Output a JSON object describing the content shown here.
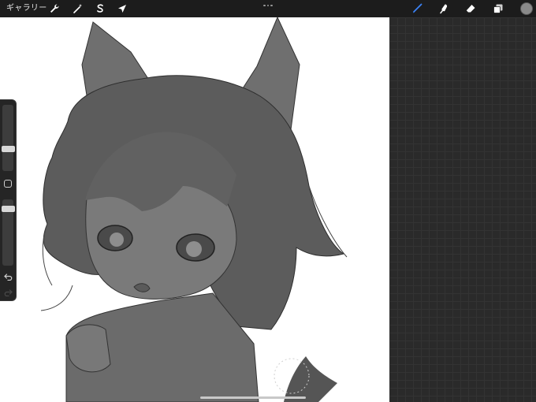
{
  "toolbar": {
    "gallery_label": "ギャラリー",
    "left_tools": [
      {
        "name": "actions",
        "icon": "wrench-icon"
      },
      {
        "name": "adjustments",
        "icon": "magic-wand-icon"
      },
      {
        "name": "selection",
        "icon": "selection-s-icon"
      },
      {
        "name": "transform",
        "icon": "arrow-cursor-icon"
      }
    ],
    "right_tools": [
      {
        "name": "brush",
        "icon": "brush-icon",
        "active": true
      },
      {
        "name": "smudge",
        "icon": "smudge-icon",
        "active": false
      },
      {
        "name": "eraser",
        "icon": "eraser-icon",
        "active": false
      },
      {
        "name": "layers",
        "icon": "layers-icon",
        "active": false
      }
    ],
    "active_color": "#8a8a8a",
    "accent_color": "#3b82f6"
  },
  "sidebar": {
    "brush_size_level": 0.5,
    "opacity_level": 0.1,
    "buttons": [
      "modify-button",
      "undo-button",
      "redo-button"
    ]
  },
  "canvas": {
    "background": "#ffffff",
    "content": "illustration"
  }
}
